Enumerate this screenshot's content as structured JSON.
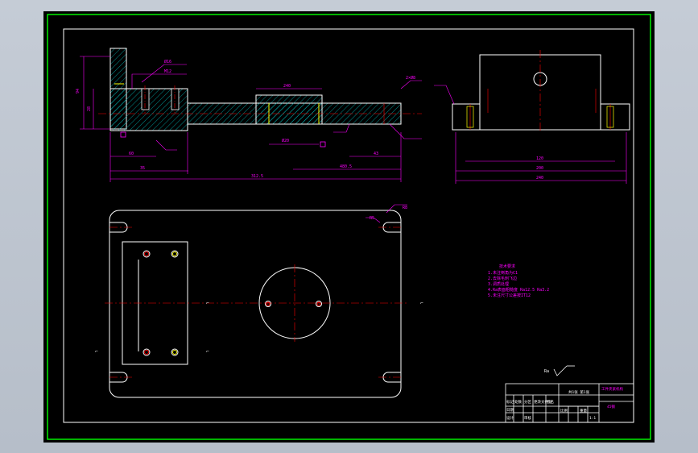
{
  "drawing": {
    "scale_note": "1:1",
    "colors": {
      "background": "#000000",
      "frame": "#00ff00",
      "outline": "#ffffff",
      "dimension": "#ff00ff",
      "centerline": "#ff0000",
      "hatch": "#00cccc",
      "hidden": "#ffff00"
    },
    "front_view_dims": [
      "94",
      "28",
      "60",
      "35",
      "312.5",
      "480.5",
      "43",
      "240",
      "30",
      "Ø20",
      "M12",
      "Ø16",
      "2×Ø8"
    ],
    "side_view_dims": [
      "120",
      "200",
      "240"
    ],
    "plan_view_dims": [
      "R8",
      "R5",
      "Ø20"
    ],
    "tech_notes": [
      "技术要求",
      "1.未注倒角为C1",
      "2.去除毛刺飞边",
      "3.调质处理",
      "4.Ra表面粗糙度 Ra12.5 Ra3.2",
      "5.未注尺寸公差按IT12"
    ],
    "title_block": {
      "part_name": "工件夹紧机构",
      "drawing_no": "45钢",
      "sheet": "共1张 第1张",
      "row_labels": [
        "标记",
        "处数",
        "分区",
        "更改文件号",
        "签名",
        "日期"
      ],
      "scale_label": "比例",
      "weight_label": "重量",
      "designer_label": "设计",
      "checker_label": "审核"
    },
    "roughness_mark": "Ra"
  }
}
